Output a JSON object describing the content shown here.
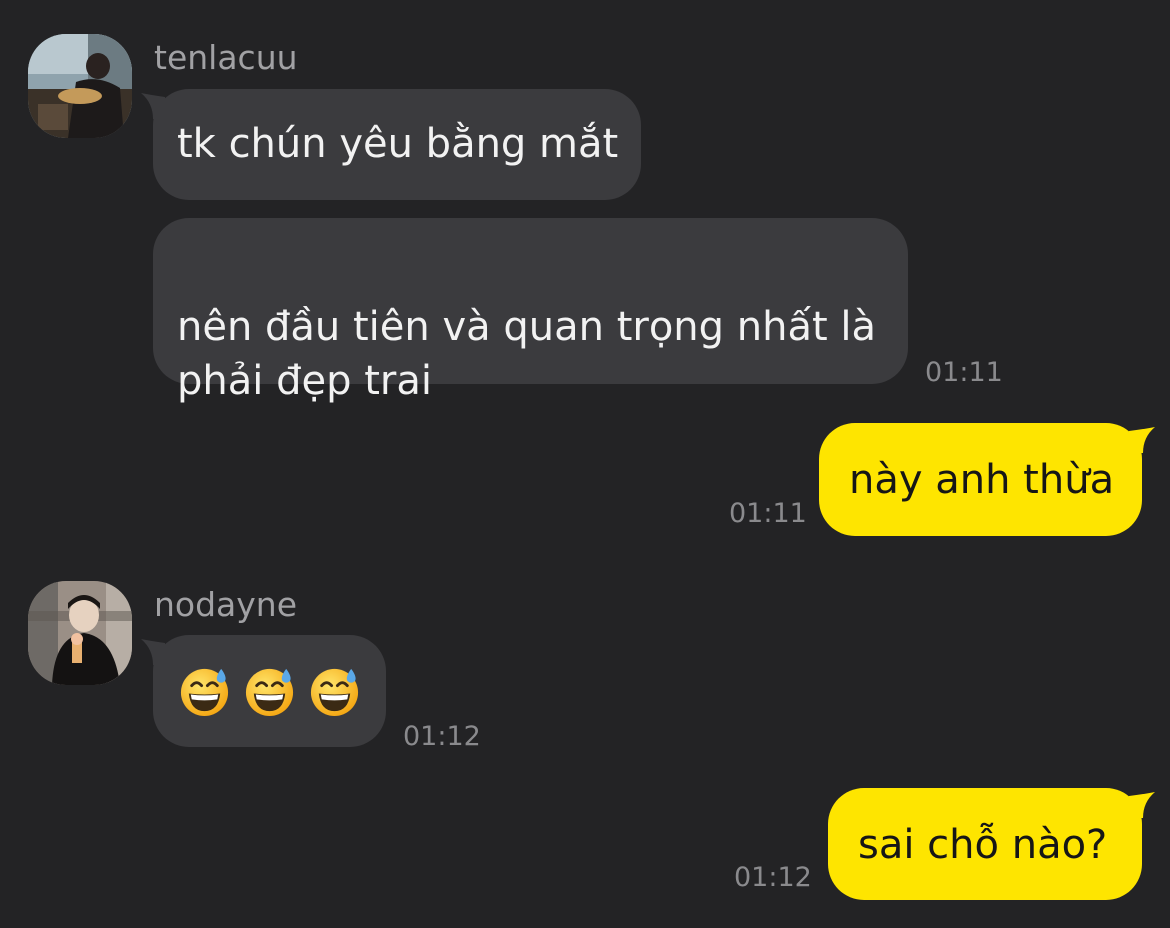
{
  "messages": [
    {
      "sender": "tenlacuu",
      "bubbles": [
        "tk chún yêu bằng mắt",
        "nên đầu tiên và quan trọng nhất là\nphải đẹp trai"
      ],
      "time": "01:11"
    },
    {
      "outgoing": true,
      "text": "này anh thừa",
      "time": "01:11"
    },
    {
      "sender": "nodayne",
      "emoji_icons": [
        "grinning-face-with-sweat-icon",
        "grinning-face-with-sweat-icon",
        "grinning-face-with-sweat-icon"
      ],
      "time": "01:12"
    },
    {
      "outgoing": true,
      "text": "sai chỗ nào?",
      "time": "01:12"
    }
  ],
  "colors": {
    "background": "#232325",
    "incoming_bubble": "#3b3b3e",
    "outgoing_bubble": "#fee500",
    "timestamp": "#8a8a8d"
  }
}
